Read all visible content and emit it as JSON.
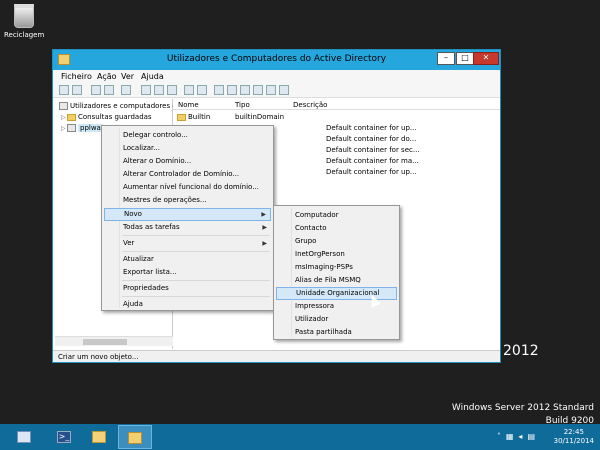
{
  "desktop": {
    "recycle_bin_label": "Reciclagem",
    "brand_year": "2012",
    "brand_edition": "Windows Server 2012 Standard",
    "brand_build": "Build 9200"
  },
  "window": {
    "title": "Utilizadores e Computadores do Active Directory",
    "title_bar_color": "#25a6dd",
    "buttons": {
      "minimize": "–",
      "maximize": "□",
      "close": "✕"
    }
  },
  "menubar": [
    "Ficheiro",
    "Ação",
    "Ver",
    "Ajuda"
  ],
  "tree": {
    "root": "Utilizadores e computadores do",
    "saved_queries": "Consultas guardadas",
    "domain": "pplwa"
  },
  "list": {
    "columns": [
      "Nome",
      "Tipo",
      "Descrição"
    ],
    "rows": [
      {
        "name": "Builtin",
        "type": "builtinDomain",
        "description": ""
      },
      {
        "name": "",
        "type": "",
        "description": "Default container for up..."
      },
      {
        "name": "",
        "type": "",
        "description": "Default container for do..."
      },
      {
        "name": "",
        "type": "",
        "description": "Default container for sec..."
      },
      {
        "name": "",
        "type": "",
        "description": "Default container for ma..."
      },
      {
        "name": "",
        "type": "",
        "description": "Default container for up..."
      }
    ]
  },
  "context_menu": {
    "items": [
      "Delegar controlo...",
      "Localizar...",
      "Alterar o Domínio...",
      "Alterar Controlador de Domínio...",
      "Aumentar nível funcional do domínio...",
      "Mestres de operações...",
      "Novo",
      "Todas as tarefas",
      "Ver",
      "Atualizar",
      "Exportar lista...",
      "Propriedades",
      "Ajuda"
    ],
    "highlighted": "Novo"
  },
  "submenu_new": {
    "items": [
      "Computador",
      "Contacto",
      "Grupo",
      "InetOrgPerson",
      "msImaging-PSPs",
      "Alias de Fila MSMQ",
      "Unidade Organizacional",
      "Impressora",
      "Utilizador",
      "Pasta partilhada"
    ],
    "highlighted": "Unidade Organizacional"
  },
  "statusbar": {
    "text": "Criar um novo objeto..."
  },
  "taskbar": {
    "powershell_glyph": ">_",
    "clock_time": "22:45",
    "clock_date": "30/11/2014",
    "accent": "#0f6b9a"
  }
}
